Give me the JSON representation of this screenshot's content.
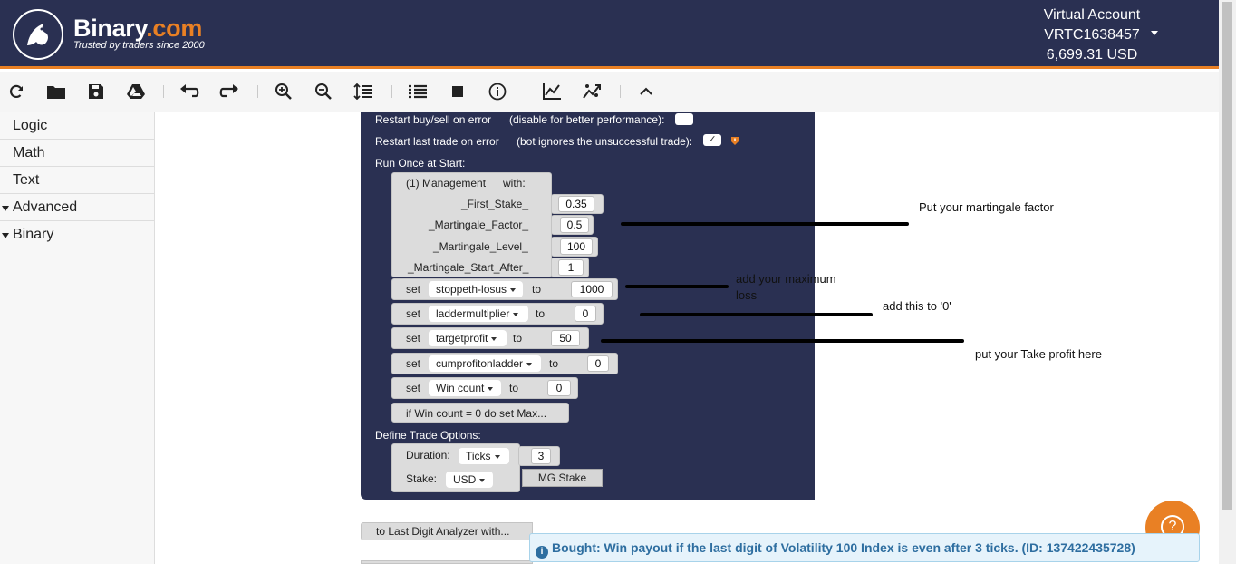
{
  "header": {
    "brand_name": "Binary",
    "brand_tld": ".com",
    "tagline": "Trusted by traders since 2000",
    "account_type": "Virtual Account",
    "account_id": "VRTC1638457",
    "balance": "6,699.31 USD"
  },
  "toolbar": {
    "icons": [
      "reload-icon",
      "open-folder-icon",
      "save-icon",
      "google-drive-icon",
      "undo-icon",
      "redo-icon",
      "zoom-in-icon",
      "zoom-out-icon",
      "sort-icon",
      "summary-icon",
      "stop-icon",
      "info-icon",
      "chart-icon",
      "trading-view-icon",
      "collapse-icon"
    ]
  },
  "sidebar": {
    "items": [
      {
        "label": "Logic"
      },
      {
        "label": "Math"
      },
      {
        "label": "Text"
      },
      {
        "label": "Advanced"
      },
      {
        "label": "Binary"
      }
    ]
  },
  "blocks": {
    "restart_error_label": "Restart buy/sell on error",
    "restart_error_note": "(disable for better performance):",
    "restart_last_label": "Restart last trade on error",
    "restart_last_note": "(bot ignores the unsuccessful trade):",
    "restart_last_check": "✓",
    "run_once": "Run Once at Start:",
    "management_title": "(1) Management",
    "management_with": "with:",
    "params": [
      {
        "label": "_First_Stake_",
        "value": "0.35"
      },
      {
        "label": "_Martingale_Factor_",
        "value": "0.5"
      },
      {
        "label": "_Martingale_Level_",
        "value": "100"
      },
      {
        "label": "_Martingale_Start_After_",
        "value": "1"
      }
    ],
    "set_word": "set",
    "to_word": "to",
    "sets": [
      {
        "var": "stoppeth-losus",
        "value": "1000"
      },
      {
        "var": "laddermultiplier",
        "value": "0"
      },
      {
        "var": "targetprofit",
        "value": "50"
      },
      {
        "var": "cumprofitonladder",
        "value": "0"
      },
      {
        "var": "Win count",
        "value": "0"
      }
    ],
    "if_block": "if Win count = 0 do set Max...",
    "define_trade": "Define Trade Options:",
    "duration_label": "Duration:",
    "duration_unit": "Ticks",
    "duration_value": "3",
    "stake_label": "Stake:",
    "stake_currency": "USD",
    "stake_value": "MG Stake",
    "last_digit": "to Last Digit Analyzer with..."
  },
  "annotations": {
    "martingale": "Put your martingale factor",
    "max_loss_1": "add your maximum",
    "max_loss_2": "loss",
    "ladder": "add this to '0'",
    "take_profit": "put your Take profit here"
  },
  "help_icon": "?",
  "toast": {
    "icon": "i",
    "message": "Bought: Win payout if the last digit of Volatility 100 Index is even after 3 ticks. (ID: 137422435728)"
  },
  "colors": {
    "header_bg": "#2a3052",
    "accent": "#e98024",
    "block_grey": "#dcdcdc",
    "toast_text": "#2e6ea0"
  }
}
